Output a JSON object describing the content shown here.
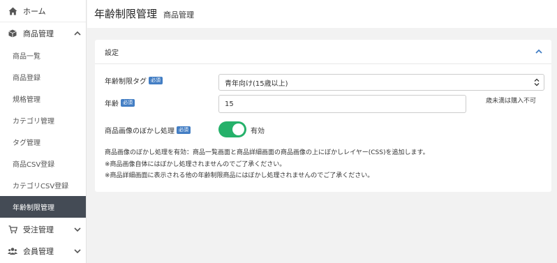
{
  "sidebar": {
    "home_label": "ホーム",
    "product_group_label": "商品管理",
    "product_items": [
      "商品一覧",
      "商品登録",
      "規格管理",
      "カテゴリ管理",
      "タグ管理",
      "商品CSV登録",
      "カテゴリCSV登録",
      "年齢制限管理"
    ],
    "order_group_label": "受注管理",
    "member_group_label": "会員管理"
  },
  "header": {
    "title": "年齢制限管理",
    "subtitle": "商品管理"
  },
  "card": {
    "title": "設定",
    "fields": {
      "age_tag": {
        "label": "年齢制限タグ",
        "required_badge": "必須",
        "selected_value": "青年向け(15歳以上)"
      },
      "age": {
        "label": "年齢",
        "required_badge": "必須",
        "value": "15",
        "hint": "歳未満は購入不可"
      },
      "blur": {
        "label": "商品画像のぼかし処理",
        "required_badge": "必須",
        "toggle_on": true,
        "toggle_label": "有効"
      }
    },
    "notes": [
      "商品画像のぼかし処理を有効：商品一覧画面と商品詳細画面の商品画像の上にぼかしレイヤー(CSS)を追加します。",
      "※商品画像自体にはぼかし処理されませんのでご了承ください。",
      "※商品詳細画面に表示される他の年齢制限商品にはぼかし処理されませんのでご了承ください。"
    ]
  },
  "colors": {
    "accent_blue": "#437ec4",
    "toggle_green": "#25b16a",
    "active_sidebar": "#444b55"
  }
}
